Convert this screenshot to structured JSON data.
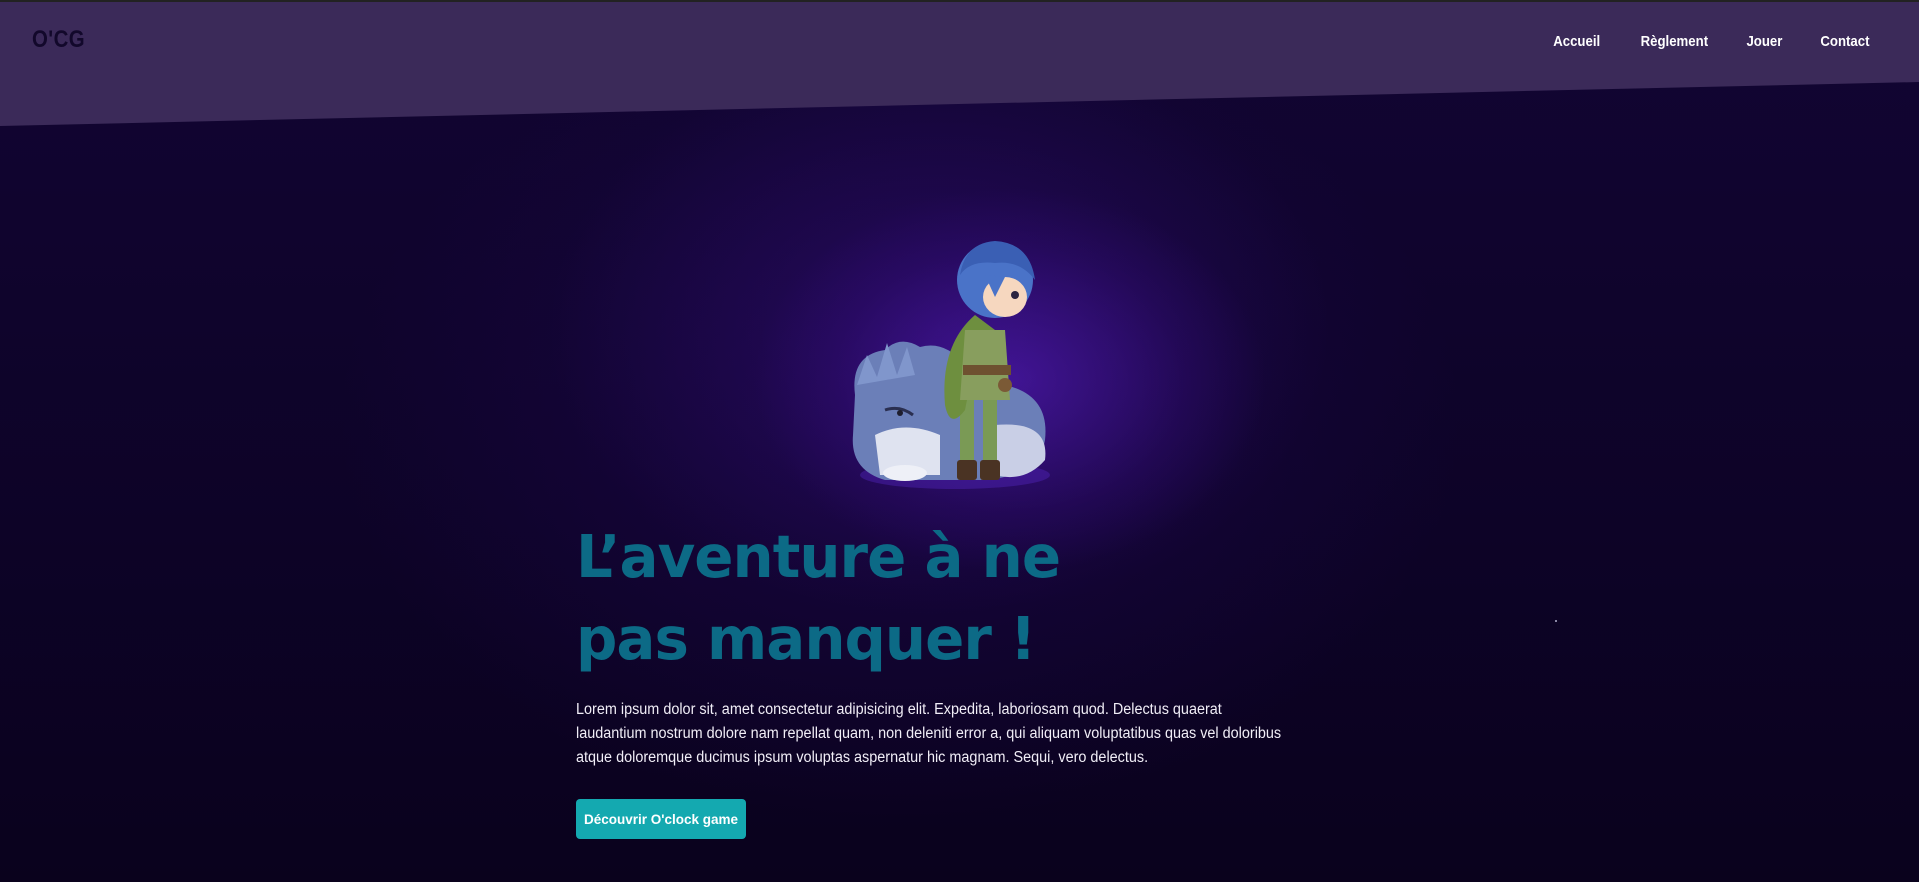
{
  "header": {
    "logo": "O'CG",
    "nav": [
      {
        "label": "Accueil"
      },
      {
        "label": "Règlement"
      },
      {
        "label": "Jouer"
      },
      {
        "label": "Contact"
      }
    ]
  },
  "hero": {
    "title": "L’aventure à ne pas manquer !",
    "text": "Lorem ipsum dolor sit, amet consectetur adipisicing elit. Expedita, laboriosam quod. Delectus quaerat laudantium nostrum dolore nam repellat quam, non deleniti error a, qui aliquam voluptatibus quas vel doloribus atque doloremque ducimus ipsum voluptas aspernatur hic magnam. Sequi, vero delectus.",
    "cta_label": "Découvrir O'clock game",
    "illustration": "character-with-wolf-illustration"
  },
  "colors": {
    "header_bg": "#3b2a59",
    "page_bg": "#0d0327",
    "title": "#0c6a86",
    "cta_bg": "#14a9b0"
  }
}
